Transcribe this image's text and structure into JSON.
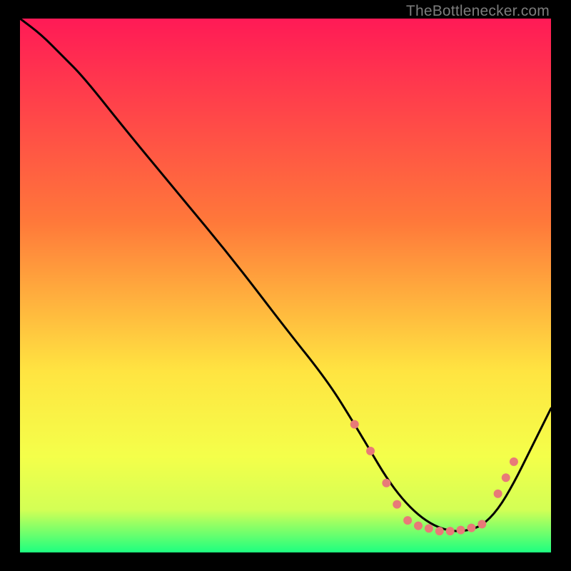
{
  "watermark": "TheBottlenecker.com",
  "chart_data": {
    "type": "line",
    "title": "",
    "xlabel": "",
    "ylabel": "",
    "xlim": [
      0,
      100
    ],
    "ylim": [
      0,
      100
    ],
    "grid": false,
    "gradient_colors": {
      "top": "#ff1a56",
      "mid_upper": "#ff783a",
      "mid": "#ffe441",
      "mid_lower": "#f4ff4a",
      "bottom": "#1dff80"
    },
    "series": [
      {
        "name": "curve",
        "x": [
          0,
          4,
          8,
          12,
          20,
          30,
          40,
          50,
          58,
          63,
          66,
          69,
          72,
          75,
          78,
          81,
          84,
          87,
          90,
          93,
          96,
          100
        ],
        "y": [
          100,
          97,
          93,
          89,
          79,
          67,
          55,
          42,
          32,
          24,
          19,
          14,
          10,
          7,
          5,
          4,
          4,
          5,
          8,
          13,
          19,
          27
        ]
      }
    ],
    "markers": {
      "name": "optimal-range-dots",
      "color": "#e87a78",
      "radius": 6,
      "points": [
        {
          "x": 63,
          "y": 24
        },
        {
          "x": 66,
          "y": 19
        },
        {
          "x": 69,
          "y": 13
        },
        {
          "x": 71,
          "y": 9
        },
        {
          "x": 73,
          "y": 6
        },
        {
          "x": 75,
          "y": 5
        },
        {
          "x": 77,
          "y": 4.5
        },
        {
          "x": 79,
          "y": 4
        },
        {
          "x": 81,
          "y": 4
        },
        {
          "x": 83,
          "y": 4.2
        },
        {
          "x": 85,
          "y": 4.6
        },
        {
          "x": 87,
          "y": 5.3
        },
        {
          "x": 90,
          "y": 11
        },
        {
          "x": 91.5,
          "y": 14
        },
        {
          "x": 93,
          "y": 17
        }
      ]
    }
  }
}
